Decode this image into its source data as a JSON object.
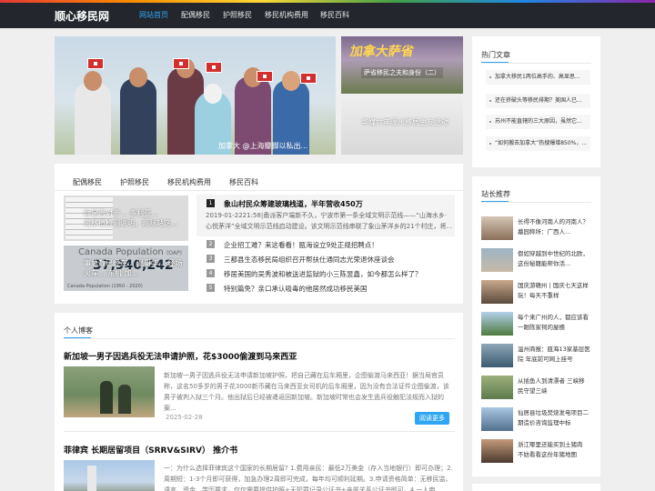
{
  "site": {
    "name": "顺心移民网"
  },
  "nav": {
    "items": [
      "网站首页",
      "配偶移民",
      "护照移民",
      "移民机构费用",
      "移民百科"
    ]
  },
  "banners": {
    "main_caption": "加拿大 @上海瓣脚以私出...",
    "side1_title": "加拿大萨省",
    "side1_sub": "萨省移民之夫和身份（二）",
    "side2_caption": "华媒六年温州移居生友活动"
  },
  "tabs": [
    "配偶移民",
    "护照移民",
    "移民机构费用",
    "移民百科"
  ],
  "image_blocks": {
    "block1_caption": "你是否对于... 多利亚...\n海移植检测说明，两际站这...",
    "block2_title": "Canada Population",
    "block2_title_small": "(OAP)",
    "block2_number": "37,940,242",
    "block2_caption": "事总数已经在... 温哥华... 经场\n火车... 东机 加...",
    "block2_foot": "Canada Population (1950 - 2020)"
  },
  "featured": {
    "number": "1",
    "title": "象山村民众筹建玻璃栈道，半年营收450万",
    "desc": "2019-01-2221:58|甬派客户端新不久，宁波市第一条全域文明示范线——“山海水乡·心悦茅洋”全域文明示范线启动建设。该文明示范线串联了象山茅洋乡的21个村庄，将..."
  },
  "news_list": [
    {
      "num": "2",
      "title": "企业招工难？来这看看！瓯海设立9处正规招聘点！"
    },
    {
      "num": "3",
      "title": "三都县生态移民局组织召开帮扶仕通同志光荣退休座谈会"
    },
    {
      "num": "4",
      "title": "移居美国的吴秀波和被送进监狱的小三陈昱鑫，如今都怎么样了？"
    },
    {
      "num": "5",
      "title": "特别篇免？亲口承认吸毒的他居然成功移民美国"
    }
  ],
  "blog_section": {
    "title": "个人博客",
    "posts": [
      {
        "title": "新加坡一男子因逃兵役无法申请护照，花$3000偷渡到马来西亚",
        "desc": "新加坡一男子因逃兵役无法申请新加坡护照，把自己藏在后车厢里，企图偷渡马来西亚！据当局官员称，这名50多岁的男子花3000新币藏在马来西亚女司机的后车厢里，因为没有合法证件企图偷渡，该男子被判入狱三个月。他出狱后已经被遣返回新加坡。新加坡时常也会发生逃兵役触犯法规而入狱的案...",
        "date": "2025-02-28",
        "more": "阅读更多"
      },
      {
        "title": "菲律宾 长期居留项目（SRRV&SIRV） 推介书",
        "desc": "一：为什么选择菲律宾这个国家的长期居留? 1.费用亲民：最低2万美金（存入当地银行）即可办理；2.周期短：1-3个月即可获得，加急办理2周即可完成，每年均可顺利延期。3.申请资格简单：无移民监、语言、资金、学历要求，仅仅需要提供护照+无犯罪记录公证书+亲属关系公证书即可。4.一人申请，..."
      }
    ]
  },
  "sidebar": {
    "hot_title": "热门文章",
    "hot_items": [
      "加拿大移民1两位高手的、高显思...",
      "还在挤破头等移民排期？美国人已...",
      "苏州不能直辖的三大原因，虽然它...",
      "“如何搬去加拿大”热搜爆增850%，..."
    ],
    "rec_title": "站长推荐",
    "rec_items": [
      "长得不像河南人的河南人？墓园称所：广西人...",
      "假如穿越到中世纪的北欧，这份秘籍能帮你活...",
      "国庆游赣州 | 国庆七天这样玩！每天不重样",
      "每个来广州的人，都应该看一眼陈家祠的屋檐",
      "温州商报：瓯海13家基层医院 年底前可网上挂号",
      "从插鱼人到清漂者 三峡移民守望三峡",
      "仙居县垃圾焚烧发电项目二期造价咨询监理中标",
      "浙江哪里还能买到土猪肉 不妨看看这份年猪地图"
    ]
  },
  "colors": {
    "accent": "#2ea6f2",
    "nav_bg": "#23272d",
    "page_bg": "#efefef"
  }
}
